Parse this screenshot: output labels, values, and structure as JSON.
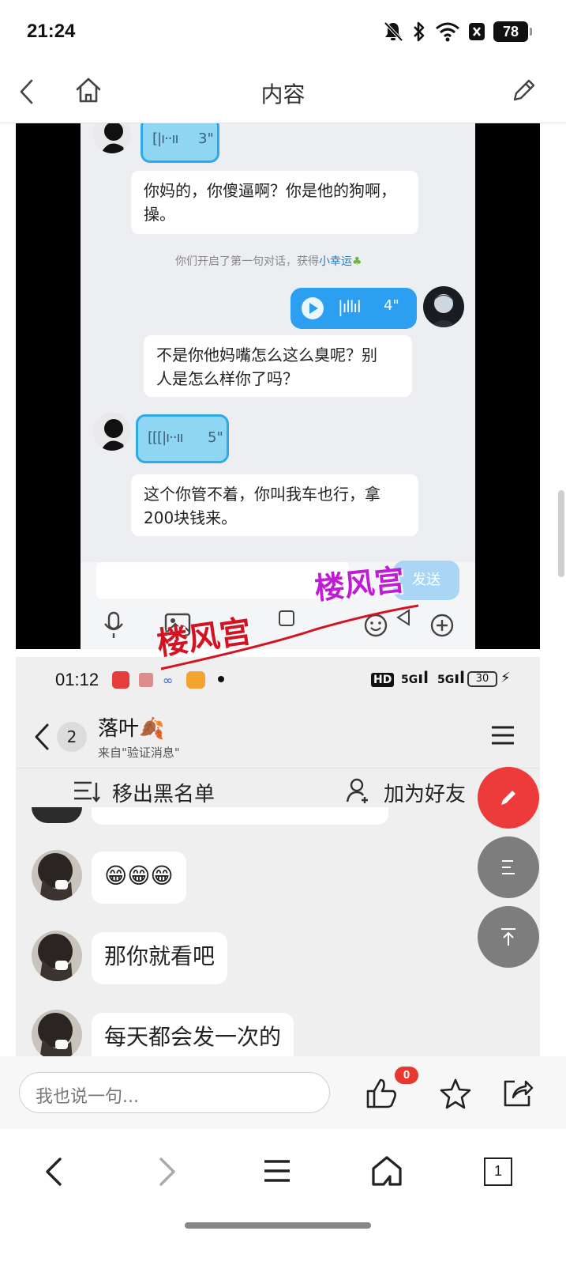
{
  "status_bar": {
    "time": "21:24",
    "battery": "78",
    "icons": [
      "bell-off-icon",
      "bluetooth-icon",
      "wifi-icon",
      "nfc-icon",
      "battery-icon"
    ]
  },
  "nav": {
    "title": "内容",
    "back_icon": "chevron-left-icon",
    "home_icon": "home-icon",
    "edit_icon": "pencil-icon"
  },
  "screenshot1": {
    "messages": [
      {
        "type": "voice",
        "side": "left",
        "duration": "3\""
      },
      {
        "type": "text",
        "side": "left",
        "text_line1": "你妈的，你傻逼啊？你是他的狗啊，",
        "text_line2": "操。"
      },
      {
        "type": "system",
        "prefix": "你们开启了第一句对话，获得",
        "highlight": "小幸运"
      },
      {
        "type": "voice",
        "side": "right",
        "duration": "4\""
      },
      {
        "type": "text",
        "side": "right",
        "text_line1": "不是你他妈嘴怎么这么臭呢？别",
        "text_line2": "人是怎么样你了吗？"
      },
      {
        "type": "voice",
        "side": "left",
        "duration": "5\""
      },
      {
        "type": "text",
        "side": "left",
        "text_line1": "这个你管不着，你叫我车也行，拿",
        "text_line2": "200块钱来。"
      }
    ],
    "send_label": "发送"
  },
  "watermarks": [
    "楼风宫",
    "楼风宫"
  ],
  "screenshot2": {
    "time": "01:12",
    "signal": {
      "hd": "HD",
      "net1": "5G",
      "net2": "5G",
      "battery": "30"
    },
    "contact": {
      "back_count": "2",
      "name": "落叶🍂",
      "source": "来自\"验证消息\""
    },
    "actions": {
      "unblock": "移出黑名单",
      "add_friend": "加为好友"
    },
    "messages": [
      {
        "text": "😁😁😁"
      },
      {
        "text": "那你就看吧"
      },
      {
        "text": "每天都会发一次的"
      }
    ]
  },
  "floating_buttons": {
    "edit": "pencil-icon",
    "outline": "outline-icon",
    "top": "back-to-top-icon"
  },
  "comment_bar": {
    "placeholder": "我也说一句...",
    "like_count": "0",
    "icons": [
      "thumbs-up-icon",
      "star-icon",
      "share-icon"
    ]
  },
  "bottom_nav": {
    "tabs_count": "1",
    "icons": [
      "back-arrow-icon",
      "forward-arrow-icon",
      "menu-icon",
      "home-icon",
      "tabs-icon"
    ]
  },
  "colors": {
    "accent_red": "#ed3b3b",
    "fab_gray": "#7d7d7d",
    "voice_blue": "#2c9ff0",
    "watermark": "#c8102e"
  }
}
